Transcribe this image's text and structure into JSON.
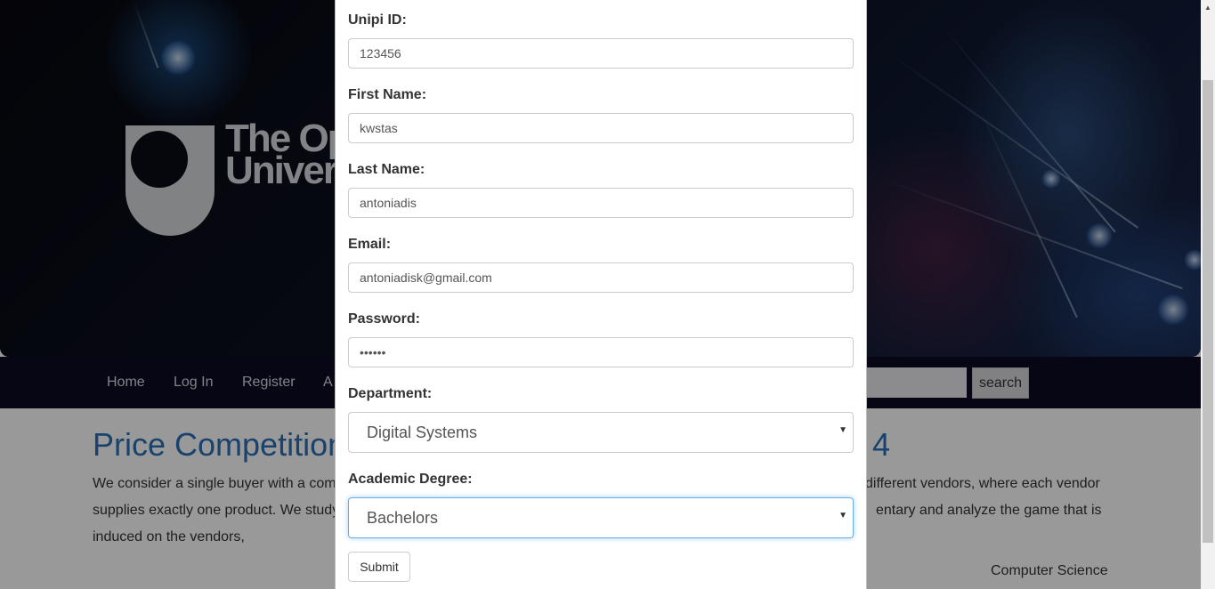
{
  "hero": {
    "logo_text_line1": "The Op",
    "logo_text_line2": "Univer"
  },
  "nav": {
    "items": [
      "Home",
      "Log In",
      "Register",
      "A"
    ],
    "search_button": "search",
    "search_placeholder": ""
  },
  "article": {
    "title": "Price Competition",
    "title_end": "4",
    "body_left": [
      "We consider a single buyer with a com",
      "supplies exactly one product. We study",
      "induced on the vendors,"
    ],
    "body_right": [
      "different vendors, where each vendor",
      "entary and analyze the game that is"
    ],
    "category": "Computer Science"
  },
  "form": {
    "unipi_id": {
      "label": "Unipi ID:",
      "value": "123456"
    },
    "first_name": {
      "label": "First Name:",
      "value": "kwstas"
    },
    "last_name": {
      "label": "Last Name:",
      "value": "antoniadis"
    },
    "email": {
      "label": "Email:",
      "value": "antoniadisk@gmail.com"
    },
    "password": {
      "label": "Password:",
      "value": "••••••"
    },
    "department": {
      "label": "Department:",
      "value": "Digital Systems"
    },
    "degree": {
      "label": "Academic Degree:",
      "value": "Bachelors"
    },
    "submit_label": "Submit"
  },
  "icons": {
    "caret": "▼",
    "scroll_up": "▲"
  }
}
